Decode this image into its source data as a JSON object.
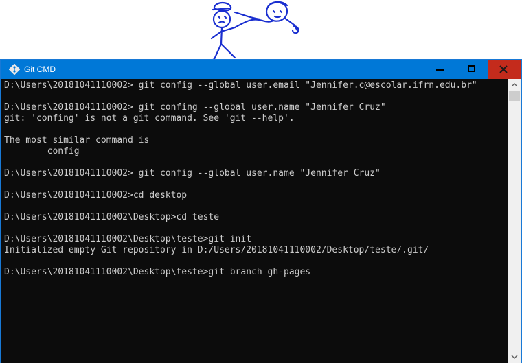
{
  "window": {
    "title": "Git CMD",
    "accent_color": "#0078d7",
    "close_color": "#c42b1c",
    "icons": {
      "app": "git-icon",
      "minimize": "minimize-icon",
      "maximize": "maximize-icon",
      "close": "close-icon"
    }
  },
  "console": {
    "background": "#0c0c0c",
    "foreground": "#cccccc",
    "lines": [
      "D:\\Users\\20181041110002> git config --global user.email \"Jennifer.c@escolar.ifrn.edu.br\"",
      "",
      "D:\\Users\\20181041110002> git confing --global user.name \"Jennifer Cruz\"",
      "git: 'confing' is not a git command. See 'git --help'.",
      "",
      "The most similar command is",
      "        config",
      "",
      "D:\\Users\\20181041110002> git config --global user.name \"Jennifer Cruz\"",
      "",
      "D:\\Users\\20181041110002>cd desktop",
      "",
      "D:\\Users\\20181041110002\\Desktop>cd teste",
      "",
      "D:\\Users\\20181041110002\\Desktop\\teste>git init",
      "Initialized empty Git repository in D:/Users/20181041110002/Desktop/teste/.git/",
      "",
      "D:\\Users\\20181041110002\\Desktop\\teste>git branch gh-pages"
    ]
  },
  "scrollbar": {
    "icons": {
      "up": "scroll-up-arrow-icon",
      "down": "scroll-down-arrow-icon"
    }
  }
}
